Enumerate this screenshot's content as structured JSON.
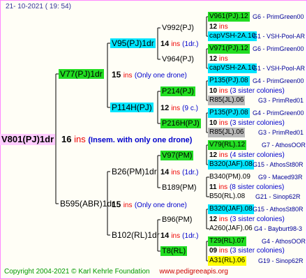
{
  "header": {
    "date": "21- 10-2021 ( 19: 54)"
  },
  "root": {
    "name": "V801(PJ)1dr",
    "num": "16",
    "ins": "ins",
    "note": "(Insem. with only one drone)"
  },
  "gen1": {
    "sire": {
      "name": "V77(PJ)1dr",
      "num": "15",
      "ins": "ins",
      "note": "(Only one drone)"
    },
    "dam": {
      "name": "B595(ABR)1dr",
      "num": "15",
      "ins": "ins",
      "note": "(Only one drone)"
    }
  },
  "gen2": {
    "ss": {
      "name": "V95(PJ)1dr",
      "num": "14",
      "ins": "ins",
      "note": "(1dr.)"
    },
    "sd": {
      "name": "P114H(PJ)",
      "num": "12",
      "ins": "ins",
      "note": "(9 c.)"
    },
    "ds": {
      "name": "B26(PM)1dr",
      "num": "14",
      "ins": "ins",
      "note": "(1dr.)"
    },
    "dd": {
      "name": "B102(RL)1dr",
      "num": "14",
      "ins": "ins",
      "note": "(1dr.)"
    }
  },
  "gen3": [
    {
      "name": "V992(PJ)",
      "num": "12",
      "ins": "ins",
      "note": ""
    },
    {
      "name": "V964(PJ)",
      "num": "12",
      "ins": "ins",
      "note": ""
    },
    {
      "name": "P214(PJ)",
      "num": "10",
      "ins": "ins",
      "note": "(3 sister colonies)"
    },
    {
      "name": "P216H(PJ)",
      "num": "10",
      "ins": "ins",
      "note": "(3 sister colonies)"
    },
    {
      "name": "V97(PM)",
      "num": "12",
      "ins": "ins",
      "note": "(4 sister colonies)"
    },
    {
      "name": "B189(PM)",
      "num": "11",
      "ins": "ins",
      "note": "(8 sister colonies)"
    },
    {
      "name": "B96(PM)",
      "num": "12",
      "ins": "ins",
      "note": "(3 sister colonies)"
    },
    {
      "name": "T8(RL)",
      "num": "09",
      "ins": "ins",
      "note": "(3 sister colonies)"
    }
  ],
  "gen4": [
    {
      "name": "V961(PJ).12",
      "info": "G6 - PrimGreen00"
    },
    {
      "name": "capVSH-2A.10",
      "info": "G1 - VSH-Pool-AR"
    },
    {
      "name": "V971(PJ).12",
      "info": "G6 - PrimGreen00"
    },
    {
      "name": "capVSH-2A.10",
      "info": "G1 - VSH-Pool-AR"
    },
    {
      "name": "P135(PJ).08",
      "info": "G4 - PrimGreen00"
    },
    {
      "name": "R85(JL).06",
      "info": "G3 - PrimRed01"
    },
    {
      "name": "P135(PJ).08",
      "info": "G4 - PrimGreen00"
    },
    {
      "name": "R85(JL).06",
      "info": "G3 - PrimRed01"
    },
    {
      "name": "V79(RL).12",
      "info": "G7 - AthosOOR"
    },
    {
      "name": "B320(JAF).08",
      "info": "G15 - AthosSt80R"
    },
    {
      "name": "B340(PM).09",
      "info": "G9 - Maced93R"
    },
    {
      "name": "B50(RL).08",
      "info": "G21 - Sinop62R"
    },
    {
      "name": "B320(JAF).08",
      "info": "G15 - AthosSt80R"
    },
    {
      "name": "A260(JAF).06",
      "info": "G4 - Bayburt98-3"
    },
    {
      "name": "T29(RL).07",
      "info": "G4 - AthosOOR"
    },
    {
      "name": "A31(RL).06",
      "info": "G19 - Sinop62R"
    }
  ],
  "footer": {
    "copyright": "Copyright 2004-2021 © Karl Kehrle Foundation",
    "site": "www.pedigreeapis.org"
  },
  "colors": {
    "green": "#22dd22",
    "cyan": "#00e5ff",
    "pink": "#ffccff",
    "gray": "#b8b8b8",
    "yellow": "#ffff00",
    "red": "#ee0000"
  }
}
